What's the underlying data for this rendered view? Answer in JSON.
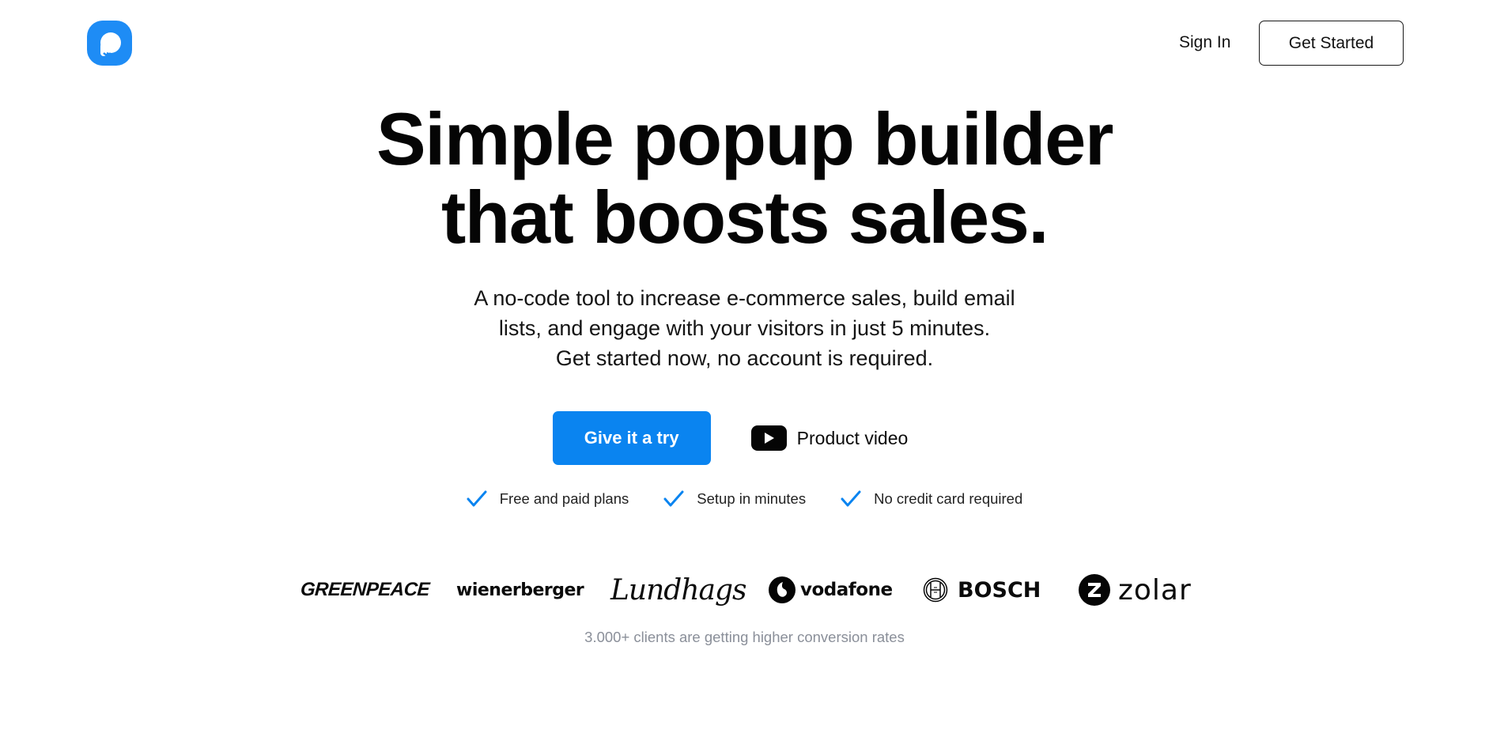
{
  "header": {
    "logo_icon": "popupsmart-logo-icon",
    "sign_in_label": "Sign In",
    "get_started_label": "Get Started"
  },
  "hero": {
    "headline_lines": [
      "Simple popup builder",
      "that boosts sales."
    ],
    "subtitle_lines": [
      "A no-code tool to increase e-commerce sales, build email",
      "lists, and engage with your visitors in just 5 minutes.",
      "Get started now, no account is required."
    ],
    "primary_cta_label": "Give it a try",
    "video_cta_label": "Product video",
    "video_icon": "youtube-play-icon"
  },
  "features": [
    {
      "icon": "check-icon",
      "label": "Free and paid plans"
    },
    {
      "icon": "check-icon",
      "label": "Setup in minutes"
    },
    {
      "icon": "check-icon",
      "label": "No credit card required"
    }
  ],
  "client_logos": [
    {
      "name": "GREENPEACE"
    },
    {
      "name": "wienerberger"
    },
    {
      "name": "Lundhags"
    },
    {
      "name": "vodafone"
    },
    {
      "name": "BOSCH"
    },
    {
      "name": "zolar"
    }
  ],
  "clients_note": "3.000+ clients are getting higher conversion rates",
  "colors": {
    "brand_blue": "#1e8cf5",
    "primary_button": "#0a84f0",
    "check_blue": "#0a84f0",
    "muted_text": "#8a8f99",
    "text": "#0b0b0b"
  }
}
